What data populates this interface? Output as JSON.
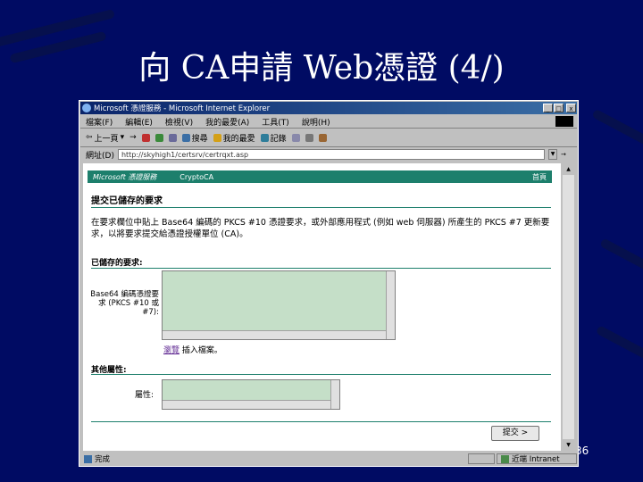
{
  "slide": {
    "title": "向 CA申請 Web憑證 (4/)",
    "page_number": "36"
  },
  "window": {
    "title": "Microsoft 憑證服務 - Microsoft Internet Explorer",
    "minimize": "_",
    "maximize": "□",
    "close": "x"
  },
  "menu": [
    "檔案(F)",
    "編輯(E)",
    "檢視(V)",
    "我的最愛(A)",
    "工具(T)",
    "說明(H)"
  ],
  "toolbar": {
    "back": "上一頁",
    "forward": "→",
    "search": "搜尋",
    "favorites": "我的最愛",
    "history": "記錄"
  },
  "address": {
    "label": "網址(D)",
    "value": "http://skyhigh1/certsrv/certrqxt.asp",
    "go": "→"
  },
  "banner": {
    "service": "Microsoft 憑證服務",
    "ca_name": "CryptoCA",
    "home": "首頁"
  },
  "page": {
    "heading": "提交已儲存的要求",
    "instructions": "在要求欄位中貼上 Base64 編碼的 PKCS #10 憑證要求，或外部應用程式 (例如 web 伺服器) 所產生的 PKCS #7 更新要求，以將要求提交給憑證授權單位 (CA)。",
    "saved_request_section": "已儲存的要求:",
    "request_field_label": "Base64 編碼憑證要求 (PKCS #10 或 #7):",
    "browse_link": "瀏覽",
    "browse_suffix": "插入檔案。",
    "other_attributes_section": "其他屬性:",
    "attributes_label": "屬性:",
    "request_value": "",
    "attributes_value": "",
    "submit_button": "提交 >"
  },
  "status": {
    "text": "完成",
    "zone": "近端 Intranet"
  }
}
